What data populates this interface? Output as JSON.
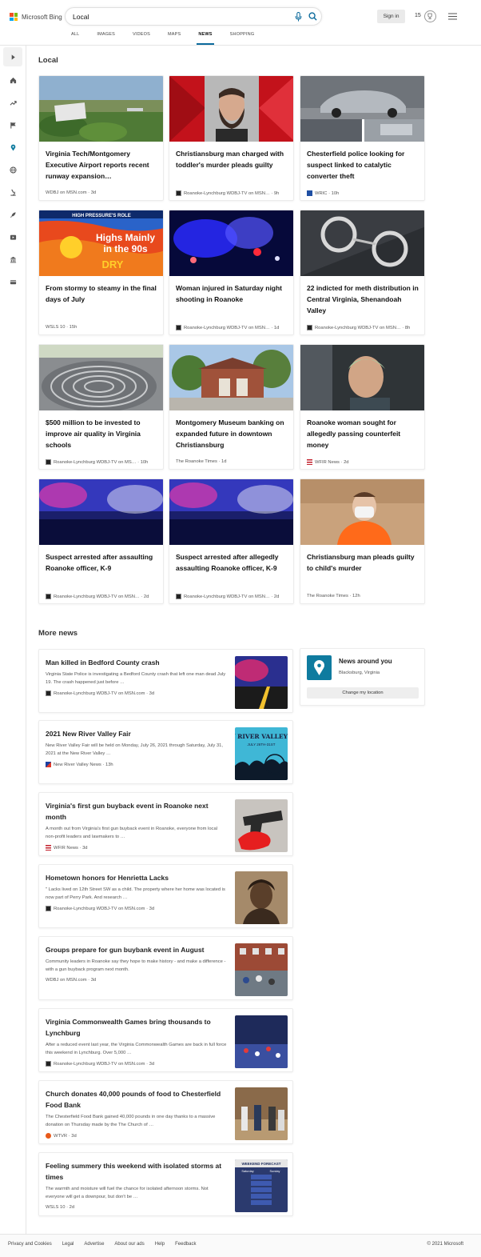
{
  "brand": {
    "name": "Microsoft Bing",
    "colors": [
      "#f25022",
      "#7fba00",
      "#00a4ef",
      "#ffb900"
    ]
  },
  "search": {
    "query": "Local"
  },
  "header": {
    "signin_label": "Sign in",
    "rewards_count": "15"
  },
  "scope_tabs": [
    {
      "label": "ALL"
    },
    {
      "label": "IMAGES"
    },
    {
      "label": "VIDEOS"
    },
    {
      "label": "MAPS"
    },
    {
      "label": "NEWS",
      "active": true
    },
    {
      "label": "SHOPPING"
    }
  ],
  "rail_icons": [
    "expand-icon",
    "home-icon",
    "trending-icon",
    "flag-icon",
    "location-icon",
    "globe-icon",
    "science-icon",
    "rocket-icon",
    "video-icon",
    "building-icon",
    "card-icon"
  ],
  "local": {
    "title": "Local",
    "cards": [
      {
        "headline": "Virginia Tech/Montgomery Executive Airport reports recent runway expansion…",
        "source": "WDBJ on MSN.com",
        "age": "3d"
      },
      {
        "headline": "Christiansburg man charged with toddler's murder pleads guilty",
        "source": "Roanoke-Lynchburg WDBJ-TV on MSN…",
        "age": "9h"
      },
      {
        "headline": "Chesterfield police looking for suspect linked to catalytic converter theft",
        "source": "WRIC",
        "age": "10h"
      },
      {
        "headline": "From stormy to steamy in the final days of July",
        "source": "WSLS 10",
        "age": "15h"
      },
      {
        "headline": "Woman injured in Saturday night shooting in Roanoke",
        "source": "Roanoke-Lynchburg WDBJ-TV on MSN…",
        "age": "1d"
      },
      {
        "headline": "22 indicted for meth distribution in Central Virginia, Shenandoah Valley",
        "source": "Roanoke-Lynchburg WDBJ-TV on MSN…",
        "age": "8h"
      },
      {
        "headline": "$500 million to be invested to improve air quality in Virginia schools",
        "source": "Roanoke-Lynchburg WDBJ-TV on MS…",
        "age": "10h"
      },
      {
        "headline": "Montgomery Museum banking on expanded future in downtown Christiansburg",
        "source": "The Roanoke Times",
        "age": "1d"
      },
      {
        "headline": "Roanoke woman sought for allegedly passing counterfeit money",
        "source": "WFIR News",
        "age": "2d"
      },
      {
        "headline": "Suspect arrested after assaulting Roanoke officer, K-9",
        "source": "Roanoke-Lynchburg WDBJ-TV on MSN…",
        "age": "2d"
      },
      {
        "headline": "Suspect arrested after allegedly assaulting Roanoke officer, K-9",
        "source": "Roanoke-Lynchburg WDBJ-TV on MSN…",
        "age": "2d"
      },
      {
        "headline": "Christiansburg man pleads guilty to child's murder",
        "source": "The Roanoke Times",
        "age": "12h"
      }
    ],
    "weather_graphic": {
      "banner": "HIGH PRESSURE'S ROLE",
      "line1": "Highs Mainly",
      "line2": "in the 90s",
      "line3": "DRY"
    }
  },
  "more_news": {
    "title": "More news",
    "items": [
      {
        "title": "Man killed in Bedford County crash",
        "snippet": "Virginia State Police is investigating a Bedford County crash that left one man dead July 19. The crash happened just before …",
        "source": "Roanoke-Lynchburg WDBJ-TV on MSN.com",
        "age": "3d"
      },
      {
        "title": "2021 New River Valley Fair",
        "snippet": "New River Valley Fair will be held on Monday, July 26, 2021 through Saturday, July 31, 2021 at the New River Valley …",
        "source": "New River Valley News",
        "age": "13h"
      },
      {
        "title": "Virginia's first gun buyback event in Roanoke next month",
        "snippet": "A month out from Virginia's first gun buyback event in Roanoke, everyone from local non-profit leaders and lawmakers to …",
        "source": "WFIR News",
        "age": "3d"
      },
      {
        "title": "Hometown honors for Henrietta Lacks",
        "snippet": "\" Lacks lived on 12th Street SW as a child. The property where her home was located is now part of Perry Park. And research …",
        "source": "Roanoke-Lynchburg WDBJ-TV on MSN.com",
        "age": "3d"
      },
      {
        "title": "Groups prepare for gun buybank event in August",
        "snippet": "Community leaders in Roanoke say they hope to make history - and make a difference - with a gun buyback program next month.",
        "source": "WDBJ on MSN.com",
        "age": "3d"
      },
      {
        "title": "Virginia Commonwealth Games bring thousands to Lynchburg",
        "snippet": "After a reduced event last year, the Virginia Commonwealth Games are back in full force this weekend in Lynchburg. Over 5,000 …",
        "source": "Roanoke-Lynchburg WDBJ-TV on MSN.com",
        "age": "3d"
      },
      {
        "title": "Church donates 40,000 pounds of food to Chesterfield Food Bank",
        "snippet": "The Chesterfield Food Bank gained 40,000 pounds in one day thanks to a massive donation on Thursday made by the The Church of …",
        "source": "WTVR",
        "age": "3d"
      },
      {
        "title": "Feeling summery this weekend with isolated storms at times",
        "snippet": "The warmth and moisture will fuel the chance for isolated afternoon storms. Not everyone will get a downpour, but don't be …",
        "source": "WSLS 10",
        "age": "2d"
      }
    ],
    "fair_graphic": {
      "line1": "W RIVER VALLEY F",
      "line2": "JULY 26TH-31ST"
    },
    "forecast_graphic": {
      "title": "WEEKEND FORECAST",
      "day1": "Saturday",
      "day2": "Sunday"
    }
  },
  "around": {
    "title": "News around you",
    "location": "Blacksburg, Virginia",
    "button": "Change my location"
  },
  "footer": {
    "links": [
      "Privacy and Cookies",
      "Legal",
      "Advertise",
      "About our ads",
      "Help",
      "Feedback"
    ],
    "copyright": "© 2021 Microsoft"
  }
}
